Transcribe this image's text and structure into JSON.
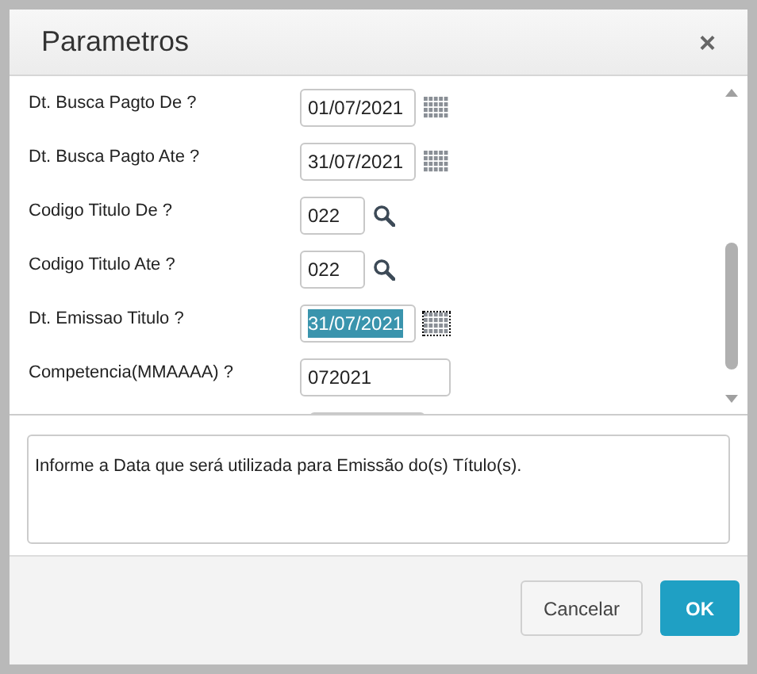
{
  "dialog": {
    "title": "Parametros",
    "close": "×"
  },
  "parameters": [
    {
      "label": "Dt. Busca Pagto De ?",
      "value": "01/07/2021",
      "kind": "date",
      "selected": false
    },
    {
      "label": "Dt. Busca Pagto Ate ?",
      "value": "31/07/2021",
      "kind": "date",
      "selected": false
    },
    {
      "label": "Codigo Titulo De ?",
      "value": "022",
      "kind": "code",
      "selected": false
    },
    {
      "label": "Codigo Titulo Ate ?",
      "value": "022",
      "kind": "code",
      "selected": false
    },
    {
      "label": "Dt. Emissao Titulo ?",
      "value": "31/07/2021",
      "kind": "date",
      "selected": true
    },
    {
      "label": "Competencia(MMAAAA) ?",
      "value": "072021",
      "kind": "text",
      "selected": false
    }
  ],
  "help_text": "Informe a Data que será utilizada para Emissão do(s) Título(s).",
  "buttons": [
    {
      "label": "Cancelar",
      "kind": "secondary"
    },
    {
      "label": "OK",
      "kind": "primary"
    }
  ]
}
